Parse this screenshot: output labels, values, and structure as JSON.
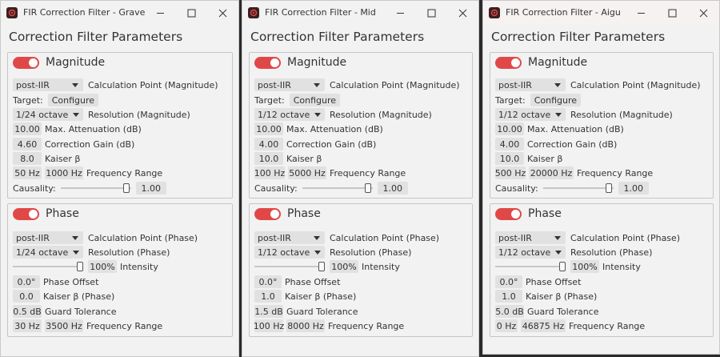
{
  "windows": [
    {
      "title": "FIR Correction Filter - Grave",
      "heading": "Correction Filter Parameters",
      "magnitude": {
        "label": "Magnitude",
        "calc_point": "post-IIR",
        "calc_point_label": "Calculation Point (Magnitude)",
        "target_label": "Target:",
        "configure_label": "Configure",
        "resolution": "1/24 octave",
        "resolution_label": "Resolution (Magnitude)",
        "max_att": "10.00",
        "max_att_label": "Max. Attenuation (dB)",
        "corr_gain": "4.60",
        "corr_gain_label": "Correction Gain (dB)",
        "kaiser": "8.0",
        "kaiser_label": "Kaiser β",
        "freq_low": "50 Hz",
        "freq_high": "1000 Hz",
        "freq_label": "Frequency Range",
        "causality_label": "Causality:",
        "causality": "1.00",
        "causality_level": 0.97
      },
      "phase": {
        "label": "Phase",
        "calc_point": "post-IIR",
        "calc_point_label": "Calculation Point (Phase)",
        "resolution": "1/24 octave",
        "resolution_label": "Resolution (Phase)",
        "intensity": "100%",
        "intensity_label": "Intensity",
        "intensity_level": 1.0,
        "offset": "0.0°",
        "offset_label": "Phase Offset",
        "kaiser": "0.0",
        "kaiser_label": "Kaiser β (Phase)",
        "guard": "0.5 dB",
        "guard_label": "Guard Tolerance",
        "freq_low": "30 Hz",
        "freq_high": "3500 Hz",
        "freq_label": "Frequency Range"
      }
    },
    {
      "title": "FIR Correction Filter - Mid",
      "heading": "Correction Filter Parameters",
      "magnitude": {
        "label": "Magnitude",
        "calc_point": "post-IIR",
        "calc_point_label": "Calculation Point (Magnitude)",
        "target_label": "Target:",
        "configure_label": "Configure",
        "resolution": "1/12 octave",
        "resolution_label": "Resolution (Magnitude)",
        "max_att": "10.00",
        "max_att_label": "Max. Attenuation (dB)",
        "corr_gain": "4.00",
        "corr_gain_label": "Correction Gain (dB)",
        "kaiser": "10.0",
        "kaiser_label": "Kaiser β",
        "freq_low": "100 Hz",
        "freq_high": "5000 Hz",
        "freq_label": "Frequency Range",
        "causality_label": "Causality:",
        "causality": "1.00",
        "causality_level": 0.97
      },
      "phase": {
        "label": "Phase",
        "calc_point": "post-IIR",
        "calc_point_label": "Calculation Point (Phase)",
        "resolution": "1/12 octave",
        "resolution_label": "Resolution (Phase)",
        "intensity": "100%",
        "intensity_label": "Intensity",
        "intensity_level": 1.0,
        "offset": "0.0°",
        "offset_label": "Phase Offset",
        "kaiser": "1.0",
        "kaiser_label": "Kaiser β (Phase)",
        "guard": "1.5 dB",
        "guard_label": "Guard Tolerance",
        "freq_low": "100 Hz",
        "freq_high": "8000 Hz",
        "freq_label": "Frequency Range"
      }
    },
    {
      "title": "FIR Correction Filter - Aigu",
      "heading": "Correction Filter Parameters",
      "magnitude": {
        "label": "Magnitude",
        "calc_point": "post-IIR",
        "calc_point_label": "Calculation Point (Magnitude)",
        "target_label": "Target:",
        "configure_label": "Configure",
        "resolution": "1/12 octave",
        "resolution_label": "Resolution (Magnitude)",
        "max_att": "10.00",
        "max_att_label": "Max. Attenuation (dB)",
        "corr_gain": "4.00",
        "corr_gain_label": "Correction Gain (dB)",
        "kaiser": "10.0",
        "kaiser_label": "Kaiser β",
        "freq_low": "500 Hz",
        "freq_high": "20000 Hz",
        "freq_label": "Frequency Range",
        "causality_label": "Causality:",
        "causality": "1.00",
        "causality_level": 0.97
      },
      "phase": {
        "label": "Phase",
        "calc_point": "post-IIR",
        "calc_point_label": "Calculation Point (Phase)",
        "resolution": "1/12 octave",
        "resolution_label": "Resolution (Phase)",
        "intensity": "100%",
        "intensity_label": "Intensity",
        "intensity_level": 1.0,
        "offset": "0.0°",
        "offset_label": "Phase Offset",
        "kaiser": "1.0",
        "kaiser_label": "Kaiser β (Phase)",
        "guard": "5.0 dB",
        "guard_label": "Guard Tolerance",
        "freq_low": "0 Hz",
        "freq_high": "46875 Hz",
        "freq_label": "Frequency Range"
      }
    }
  ],
  "colors": {
    "toggle_on": "#e04848",
    "window_bg": "#f2f2f2",
    "field_bg": "#e1e1e1",
    "desktop": "#2a2a2a"
  },
  "icons": {
    "app": "app-icon",
    "minimize": "minimize-icon",
    "maximize": "maximize-icon",
    "close": "close-icon",
    "dropdown": "chevron-down-icon"
  }
}
